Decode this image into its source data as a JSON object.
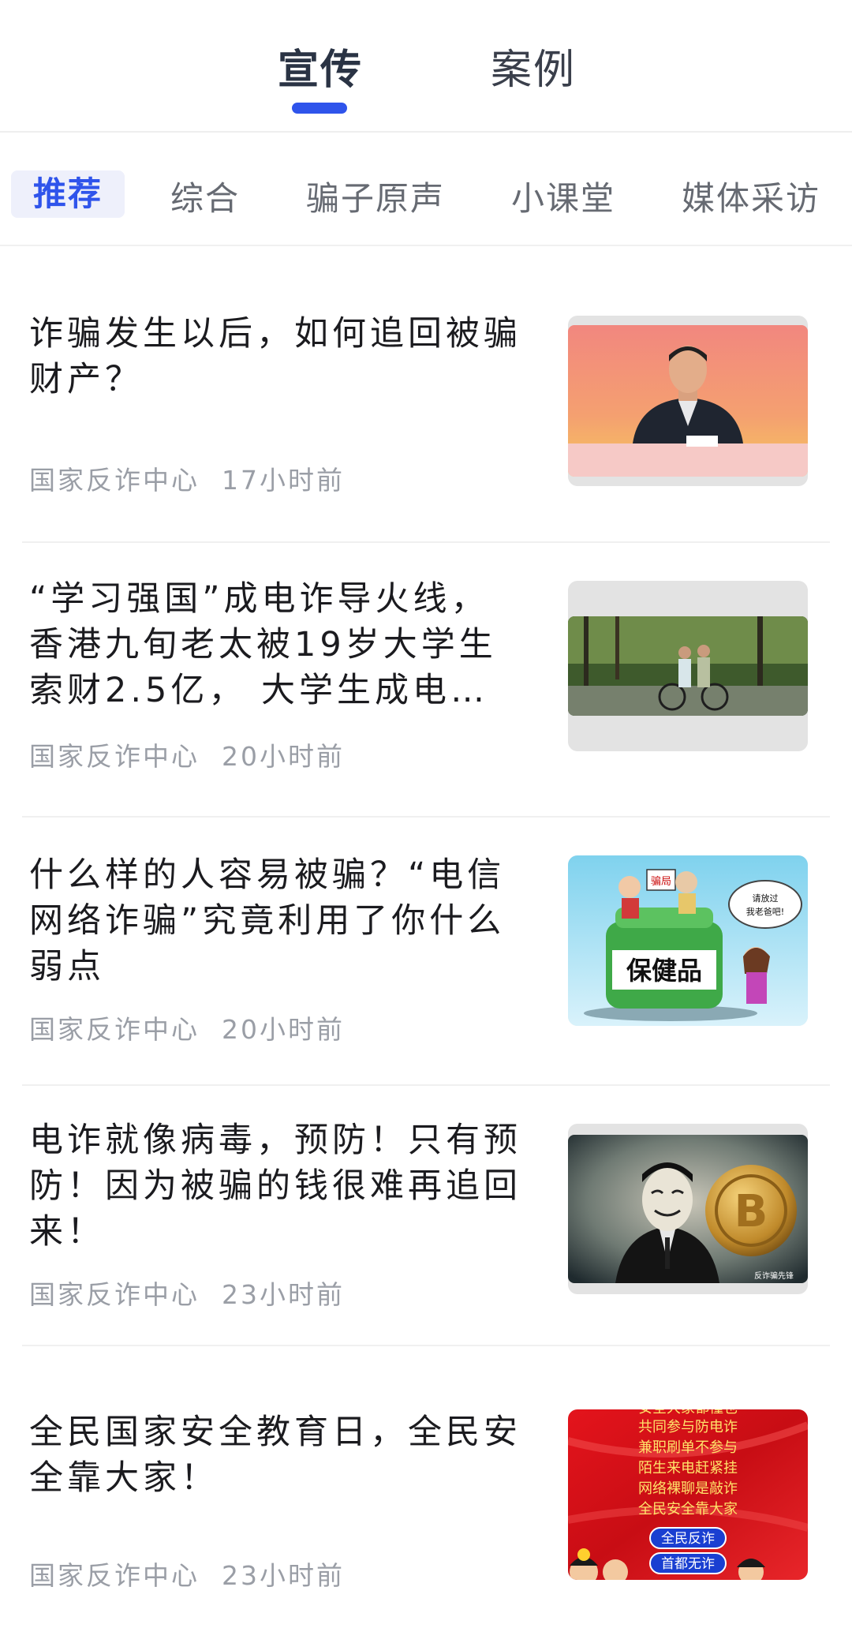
{
  "tabs": [
    {
      "label": "宣传",
      "active": true
    },
    {
      "label": "案例",
      "active": false
    }
  ],
  "categories": [
    "推荐",
    "综合",
    "骗子原声",
    "小课堂",
    "媒体采访"
  ],
  "articles": [
    {
      "title": "诈骗发生以后，如何追回被骗财产？",
      "source": "国家反诈中心",
      "time": "17小时前",
      "image": "police-officer-video-thumbnail"
    },
    {
      "title": "“学习强国”成电诈导火线，香港九旬老太被19岁大学生索财2.5亿， 大学生成电信…",
      "source": "国家反诈中心",
      "time": "20小时前",
      "image": "cyclists-forest-thumbnail"
    },
    {
      "title": "什么样的人容易被骗？“电信网络诈骗”究竟利用了你什么弱点",
      "source": "国家反诈中心",
      "time": "20小时前",
      "image": "health-product-cartoon-thumbnail"
    },
    {
      "title": "电诈就像病毒，预防！只有预防！因为被骗的钱很难再追回来！",
      "source": "国家反诈中心",
      "time": "23小时前",
      "image": "masked-man-bitcoin-thumbnail"
    },
    {
      "title": "全民国家安全教育日，全民安全靠大家！",
      "source": "国家反诈中心",
      "time": "23小时前",
      "image": "security-slogan-poster-thumbnail"
    }
  ],
  "thumb_text": {
    "cartoon_label": "保健品",
    "cartoon_bubble": "请放过我老爸吧!",
    "cartoon_sign": "骗局",
    "watermark": "反诈骗先锋",
    "poster_lines": [
      "安全大家都懂也",
      "共同参与防电诈",
      "兼职刷单不参与",
      "陌生来电赶紧挂",
      "网络裸聊是敲诈",
      "全民安全靠大家"
    ],
    "poster_buttons": [
      "全民反诈",
      "首都无诈"
    ]
  },
  "colors": {
    "accent": "#2f54eb",
    "poster_red": "#d9141b"
  }
}
